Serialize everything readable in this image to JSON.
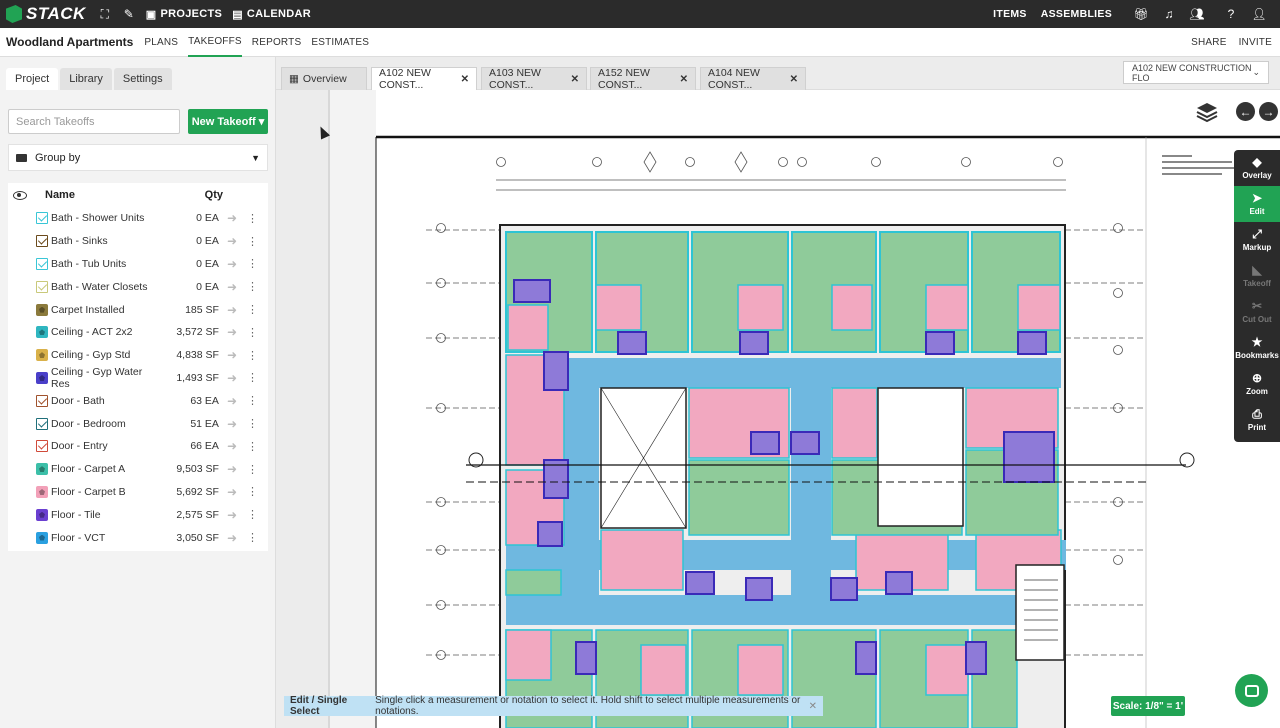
{
  "topbar": {
    "logo": "STACK",
    "projects": "PROJECTS",
    "calendar": "CALENDAR",
    "items": "ITEMS",
    "assemblies": "ASSEMBLIES"
  },
  "subnav": {
    "project_name": "Woodland Apartments",
    "items": [
      "PLANS",
      "TAKEOFFS",
      "REPORTS",
      "ESTIMATES"
    ],
    "active": "TAKEOFFS",
    "share": "SHARE",
    "invite": "INVITE"
  },
  "left": {
    "tabs": [
      "Project",
      "Library",
      "Settings"
    ],
    "search_placeholder": "Search Takeoffs",
    "new_takeoff": "New Takeoff ▾",
    "group_by": "Group by",
    "col_name": "Name",
    "col_qty": "Qty",
    "takeoffs": [
      {
        "name": "Bath - Shower Units",
        "qty": "0 EA",
        "color": "#39c6d6",
        "kind": "check"
      },
      {
        "name": "Bath - Sinks",
        "qty": "0 EA",
        "color": "#6b4a1c",
        "kind": "check"
      },
      {
        "name": "Bath - Tub Units",
        "qty": "0 EA",
        "color": "#39c6d6",
        "kind": "check"
      },
      {
        "name": "Bath - Water Closets",
        "qty": "0 EA",
        "color": "#c9c97a",
        "kind": "check"
      },
      {
        "name": "Carpet Installed",
        "qty": "185 SF",
        "color": "#8b7a3c",
        "kind": "area"
      },
      {
        "name": "Ceiling - ACT 2x2",
        "qty": "3,572 SF",
        "color": "#2fb6c0",
        "kind": "area"
      },
      {
        "name": "Ceiling - Gyp Std",
        "qty": "4,838 SF",
        "color": "#d9b14a",
        "kind": "area"
      },
      {
        "name": "Ceiling - Gyp Water Res",
        "qty": "1,493 SF",
        "color": "#4a3fc9",
        "kind": "area"
      },
      {
        "name": "Door - Bath",
        "qty": "63 EA",
        "color": "#a0522d",
        "kind": "check"
      },
      {
        "name": "Door - Bedroom",
        "qty": "51 EA",
        "color": "#1f6f7a",
        "kind": "check"
      },
      {
        "name": "Door - Entry",
        "qty": "66 EA",
        "color": "#d04a3a",
        "kind": "check"
      },
      {
        "name": "Floor - Carpet A",
        "qty": "9,503 SF",
        "color": "#3cbfa8",
        "kind": "area"
      },
      {
        "name": "Floor - Carpet B",
        "qty": "5,692 SF",
        "color": "#f2a0b8",
        "kind": "area"
      },
      {
        "name": "Floor - Tile",
        "qty": "2,575 SF",
        "color": "#6a3fd0",
        "kind": "area"
      },
      {
        "name": "Floor - VCT",
        "qty": "3,050 SF",
        "color": "#2aa0e0",
        "kind": "area"
      }
    ]
  },
  "doc_tabs": [
    {
      "label": "Overview",
      "active": false
    },
    {
      "label": "A102 NEW CONST...",
      "active": true
    },
    {
      "label": "A103 NEW CONST...",
      "active": false
    },
    {
      "label": "A152 NEW CONST...",
      "active": false
    },
    {
      "label": "A104 NEW CONST...",
      "active": false
    }
  ],
  "sheet_select": "A102 NEW CONSTRUCTION FLO",
  "tools": [
    {
      "label": "Overlay",
      "icon": "overlay-icon",
      "state": "normal"
    },
    {
      "label": "Edit",
      "icon": "pointer-icon",
      "state": "active"
    },
    {
      "label": "Markup",
      "icon": "markup-icon",
      "state": "normal"
    },
    {
      "label": "Takeoff",
      "icon": "takeoff-icon",
      "state": "disabled"
    },
    {
      "label": "Cut Out",
      "icon": "cutout-icon",
      "state": "disabled"
    },
    {
      "label": "Bookmarks",
      "icon": "star-icon",
      "state": "normal"
    },
    {
      "label": "Zoom",
      "icon": "zoom-icon",
      "state": "normal"
    },
    {
      "label": "Print",
      "icon": "print-icon",
      "state": "normal"
    }
  ],
  "status": {
    "mode": "Edit / Single Select",
    "hint": "Single click a measurement or notation to select it. Hold shift to select multiple measurements or notations."
  },
  "scale": "Scale: 1/8\" = 1'"
}
